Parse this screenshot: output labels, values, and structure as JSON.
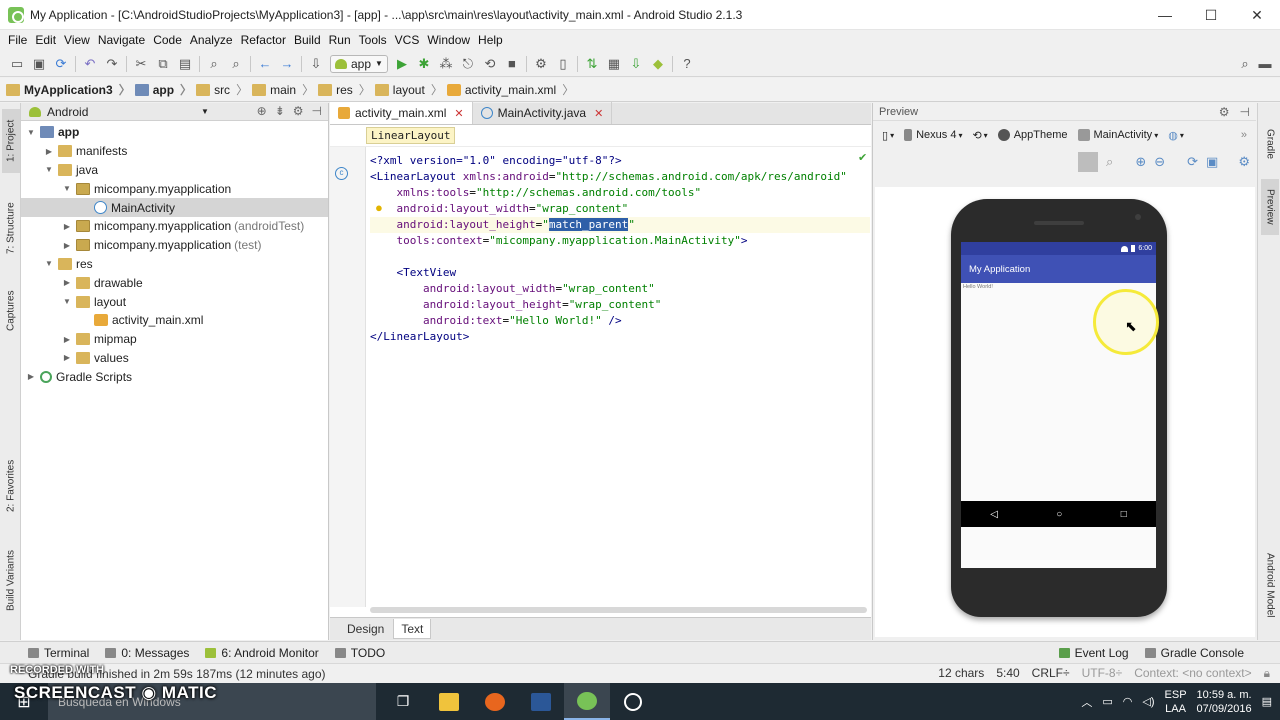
{
  "window": {
    "title": "My Application - [C:\\AndroidStudioProjects\\MyApplication3] - [app] - ...\\app\\src\\main\\res\\layout\\activity_main.xml - Android Studio 2.1.3",
    "minimize": "—",
    "maximize": "☐",
    "close": "✕"
  },
  "menu": [
    "File",
    "Edit",
    "View",
    "Navigate",
    "Code",
    "Analyze",
    "Refactor",
    "Build",
    "Run",
    "Tools",
    "VCS",
    "Window",
    "Help"
  ],
  "toolbar": {
    "run_config": "app"
  },
  "breadcrumb": [
    "MyApplication3",
    "app",
    "src",
    "main",
    "res",
    "layout",
    "activity_main.xml"
  ],
  "left_strip": {
    "project": "1: Project",
    "structure": "7: Structure",
    "captures": "Captures",
    "favorites": "2: Favorites",
    "build_variants": "Build Variants"
  },
  "right_strip": {
    "gradle": "Gradle",
    "preview": "Preview",
    "android_model": "Android Model"
  },
  "project_panel": {
    "view": "Android",
    "tree": [
      {
        "label": "app",
        "level": 0,
        "expanded": true,
        "icon": "module",
        "bold": true
      },
      {
        "label": "manifests",
        "level": 1,
        "expanded": false,
        "icon": "folder"
      },
      {
        "label": "java",
        "level": 1,
        "expanded": true,
        "icon": "folder"
      },
      {
        "label": "micompany.myapplication",
        "level": 2,
        "expanded": true,
        "icon": "pkg"
      },
      {
        "label": "MainActivity",
        "level": 3,
        "icon": "cls",
        "selected": true
      },
      {
        "label": "micompany.myapplication",
        "suffix": "(androidTest)",
        "level": 2,
        "expanded": false,
        "icon": "pkg"
      },
      {
        "label": "micompany.myapplication",
        "suffix": "(test)",
        "level": 2,
        "expanded": false,
        "icon": "pkg"
      },
      {
        "label": "res",
        "level": 1,
        "expanded": true,
        "icon": "folder"
      },
      {
        "label": "drawable",
        "level": 2,
        "expanded": false,
        "icon": "folder"
      },
      {
        "label": "layout",
        "level": 2,
        "expanded": true,
        "icon": "folder"
      },
      {
        "label": "activity_main.xml",
        "level": 3,
        "icon": "xml"
      },
      {
        "label": "mipmap",
        "level": 2,
        "expanded": false,
        "icon": "folder"
      },
      {
        "label": "values",
        "level": 2,
        "expanded": false,
        "icon": "folder"
      },
      {
        "label": "Gradle Scripts",
        "level": 0,
        "expanded": false,
        "icon": "gradle"
      }
    ]
  },
  "editor": {
    "tabs": [
      {
        "label": "activity_main.xml",
        "active": true,
        "icon": "xml"
      },
      {
        "label": "MainActivity.java",
        "active": false,
        "icon": "cls"
      }
    ],
    "breadcrumb_tag": "LinearLayout",
    "code": [
      [
        {
          "t": "<?xml version=\"1.0\" encoding=\"utf-8\"?>",
          "c": "tag"
        }
      ],
      [
        {
          "t": "<LinearLayout ",
          "c": "tag"
        },
        {
          "t": "xmlns:android",
          "c": "attr"
        },
        {
          "t": "=",
          "c": ""
        },
        {
          "t": "\"http://schemas.android.com/apk/res/android\"",
          "c": "val"
        }
      ],
      [
        {
          "t": "    xmlns:tools",
          "c": "attr"
        },
        {
          "t": "=",
          "c": ""
        },
        {
          "t": "\"http://schemas.android.com/tools\"",
          "c": "val"
        }
      ],
      [
        {
          "t": "    android:layout_width",
          "c": "attr"
        },
        {
          "t": "=",
          "c": ""
        },
        {
          "t": "\"wrap_content\"",
          "c": "val"
        }
      ],
      [
        {
          "t": "    android:layout_height",
          "c": "attr"
        },
        {
          "t": "=",
          "c": ""
        },
        {
          "t": "\"",
          "c": "val"
        },
        {
          "t": "match_parent",
          "c": "sel"
        },
        {
          "t": "\"",
          "c": "val"
        }
      ],
      [
        {
          "t": "    tools:context",
          "c": "attr"
        },
        {
          "t": "=",
          "c": ""
        },
        {
          "t": "\"micompany.myapplication.MainActivity\"",
          "c": "val"
        },
        {
          "t": ">",
          "c": "tag"
        }
      ],
      [
        {
          "t": "",
          "c": ""
        }
      ],
      [
        {
          "t": "    <TextView",
          "c": "tag"
        }
      ],
      [
        {
          "t": "        android:layout_width",
          "c": "attr"
        },
        {
          "t": "=",
          "c": ""
        },
        {
          "t": "\"wrap_content\"",
          "c": "val"
        }
      ],
      [
        {
          "t": "        android:layout_height",
          "c": "attr"
        },
        {
          "t": "=",
          "c": ""
        },
        {
          "t": "\"wrap_content\"",
          "c": "val"
        }
      ],
      [
        {
          "t": "        android:text",
          "c": "attr"
        },
        {
          "t": "=",
          "c": ""
        },
        {
          "t": "\"Hello World!\"",
          "c": "val"
        },
        {
          "t": " />",
          "c": "tag"
        }
      ],
      [
        {
          "t": "</LinearLayout>",
          "c": "tag"
        }
      ]
    ],
    "bottom_tabs": [
      "Design",
      "Text"
    ],
    "active_bottom_tab": "Text"
  },
  "preview": {
    "title": "Preview",
    "device": "Nexus 4",
    "theme": "AppTheme",
    "activity": "MainActivity",
    "phone": {
      "status_time": "6:00",
      "app_title": "My Application",
      "content_text": "Hello World!",
      "nav_back": "◁",
      "nav_home": "○",
      "nav_recent": "□"
    }
  },
  "tool_windows": {
    "terminal": "Terminal",
    "messages": "0: Messages",
    "android_monitor": "6: Android Monitor",
    "todo": "TODO",
    "event_log": "Event Log",
    "gradle_console": "Gradle Console"
  },
  "status": {
    "message": "Gradle build finished in 2m 59s 187ms (12 minutes ago)",
    "chars": "12 chars",
    "position": "5:40",
    "line_sep": "CRLF÷",
    "encoding": "UTF-8÷",
    "context": "Context: <no context>"
  },
  "taskbar": {
    "search": "Búsqueda en Windows",
    "lang1": "ESP",
    "lang2": "LAA",
    "time": "10:59 a. m.",
    "date": "07/09/2016"
  },
  "watermark": {
    "line1": "RECORDED WITH",
    "line2": "SCREENCAST ◉ MATIC"
  }
}
